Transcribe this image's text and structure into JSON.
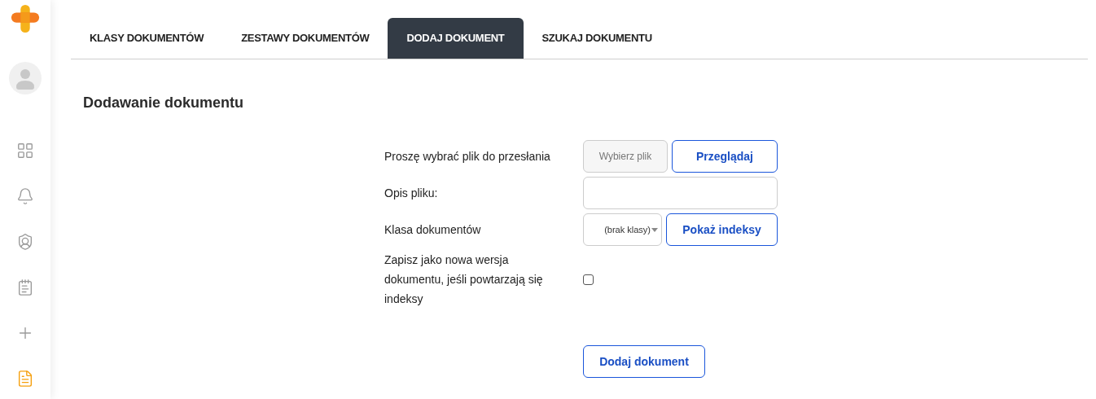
{
  "sidebar": {
    "items": [
      {
        "kind": "grid",
        "selected": false
      },
      {
        "kind": "bell",
        "selected": false
      },
      {
        "kind": "shield",
        "selected": false
      },
      {
        "kind": "checklist",
        "selected": false
      },
      {
        "kind": "plus",
        "selected": false
      },
      {
        "kind": "document",
        "selected": true
      }
    ]
  },
  "tabs": [
    {
      "label": "KLASY DOKUMENTÓW",
      "selected": false
    },
    {
      "label": "ZESTAWY DOKUMENTÓW",
      "selected": false
    },
    {
      "label": "DODAJ DOKUMENT",
      "selected": true
    },
    {
      "label": "SZUKAJ DOKUMENTU",
      "selected": false
    }
  ],
  "heading": "Dodawanie dokumentu",
  "form": {
    "rows": [
      {
        "kind": "file",
        "label": "Proszę wybrać plik do przesłania",
        "placeholder": "Wybierz plik",
        "button": "Przeglądaj"
      },
      {
        "kind": "text",
        "label": "Opis pliku:"
      },
      {
        "kind": "select",
        "label": "Klasa dokumentów",
        "value": "(brak klasy)",
        "button": "Pokaż indeksy"
      },
      {
        "kind": "checkbox",
        "label": "Zapisz jako nowa wersja dokumentu, jeśli powtarzają się indeksy",
        "checked": false
      }
    ],
    "submit": "Dodaj dokument"
  }
}
